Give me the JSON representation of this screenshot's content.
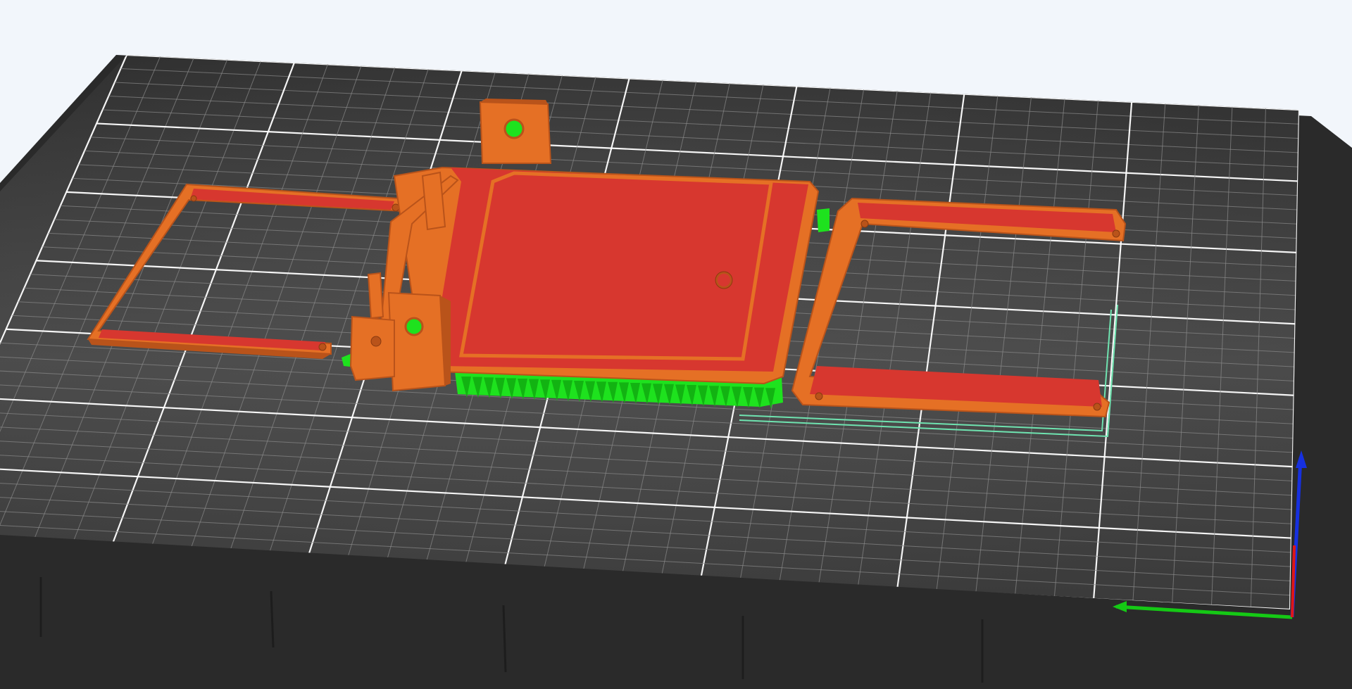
{
  "app": {
    "view": "slicer-preview-3d",
    "background_color": "#f2f6fb"
  },
  "bed": {
    "surface_color": "#3b3b3b",
    "side_color": "#2a2a2a",
    "grid_major_color": "#ffffff",
    "grid_minor_color": "#8a8a8a"
  },
  "colors": {
    "perimeter": "#e57025",
    "perimeter_shadow": "#b9531a",
    "top_solid_infill": "#d7372f",
    "support": "#1ee21e",
    "skirt": "#6fe3b0"
  },
  "axes": {
    "x_color": "#15c915",
    "y_color": "#1630e0",
    "z_color": "#e01616"
  },
  "icons": {
    "axis_gizmo": "axis-gizmo-icon"
  }
}
